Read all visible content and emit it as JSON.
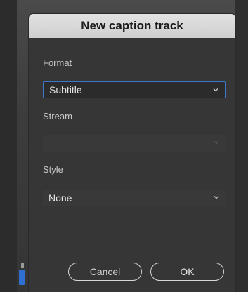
{
  "dialog": {
    "title": "New caption track",
    "format": {
      "label": "Format",
      "value": "Subtitle"
    },
    "stream": {
      "label": "Stream",
      "value": ""
    },
    "style": {
      "label": "Style",
      "value": "None"
    },
    "buttons": {
      "cancel": "Cancel",
      "ok": "OK"
    }
  },
  "icons": {
    "dropdown": "chevron-down-icon"
  },
  "colors": {
    "focus_border": "#3c78c8",
    "timeline_marker": "#2f6fd0"
  }
}
